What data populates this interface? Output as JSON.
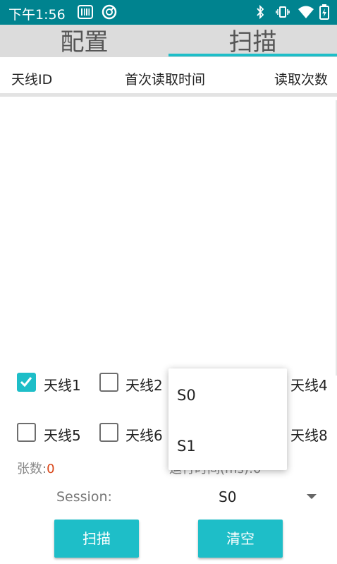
{
  "status_bar": {
    "time": "下午1:56",
    "left_icons": [
      "barcode-icon",
      "sync-icon"
    ],
    "right_icons": [
      "bluetooth-icon",
      "vibrate-icon",
      "wifi-icon",
      "battery-icon"
    ]
  },
  "tabs": [
    {
      "label": "配置",
      "selected": false
    },
    {
      "label": "扫描",
      "selected": true
    }
  ],
  "table": {
    "columns": [
      "天线ID",
      "首次读取时间",
      "读取次数"
    ],
    "rows": []
  },
  "antennas": [
    {
      "label": "天线1",
      "checked": true
    },
    {
      "label": "天线2",
      "checked": false
    },
    {
      "label": "天线4",
      "checked": false
    },
    {
      "label": "天线5",
      "checked": false
    },
    {
      "label": "天线6",
      "checked": false
    },
    {
      "label": "天线8",
      "checked": false
    }
  ],
  "stats": {
    "count_label": "张数:",
    "count_value": "0",
    "time_label": "运行时间(ms):0"
  },
  "session": {
    "label": "Session:",
    "selected": "S0",
    "options": [
      "S0",
      "S1"
    ]
  },
  "buttons": {
    "scan": "扫描",
    "clear": "清空"
  },
  "colors": {
    "status_bar": "#00838f",
    "accent": "#1ebec8",
    "count_value": "#d84315"
  }
}
